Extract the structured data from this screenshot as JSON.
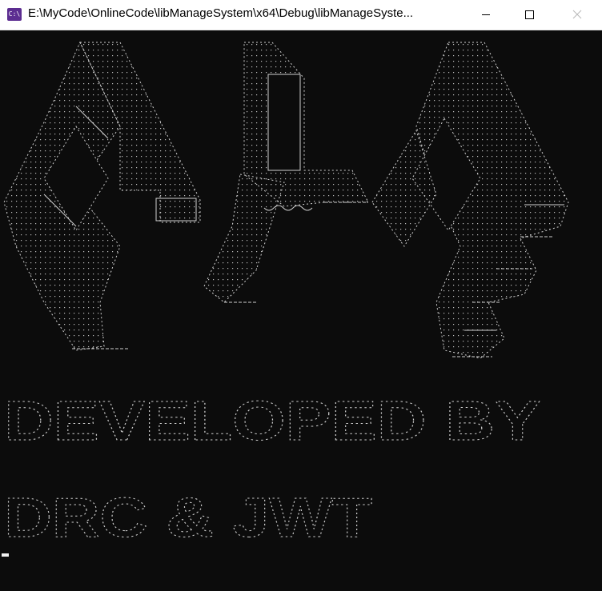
{
  "window": {
    "title": "E:\\MyCode\\OnlineCode\\libManageSystem\\x64\\Debug\\libManageSyste...",
    "icon": "console-app-icon",
    "controls": [
      "minimize-icon",
      "maximize-icon",
      "close-icon"
    ]
  },
  "console": {
    "logo": "ascii-art-logo",
    "banner_line_1": "DEVELOPED BY",
    "banner_line_2": "DRC & JWT",
    "colors": {
      "background": "#0c0c0c",
      "foreground": "#cccccc",
      "cursor": "#f2f2f2"
    }
  }
}
